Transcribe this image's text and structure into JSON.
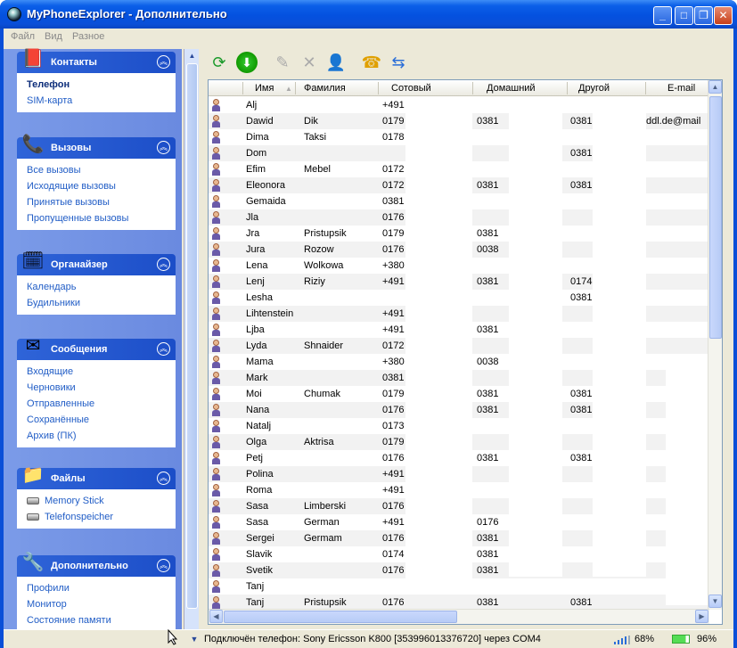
{
  "window": {
    "title": "MyPhoneExplorer -  Дополнительно"
  },
  "menu": [
    "Файл",
    "Вид",
    "Разное"
  ],
  "nav": [
    {
      "title": "Контакты",
      "icon": "contacts-book-icon",
      "items": [
        "Телефон",
        "SIM-карта"
      ],
      "selected": 0
    },
    {
      "title": "Вызовы",
      "icon": "phone-calls-icon",
      "items": [
        "Все вызовы",
        "Исходящие вызовы",
        "Принятые вызовы",
        "Пропущенные вызовы"
      ]
    },
    {
      "title": "Органайзер",
      "icon": "organizer-icon",
      "items": [
        "Календарь",
        "Будильники"
      ]
    },
    {
      "title": "Сообщения",
      "icon": "envelope-icon",
      "items": [
        "Входящие",
        "Черновики",
        "Отправленные",
        "Сохранённые",
        "Архив (ПК)"
      ]
    },
    {
      "title": "Файлы",
      "icon": "folder-icon",
      "items": [
        "Memory Stick",
        "Telefonspeicher"
      ]
    },
    {
      "title": "Дополнительно",
      "icon": "wrench-icon",
      "items": [
        "Профили",
        "Монитор",
        "Состояние памяти"
      ]
    }
  ],
  "toolbar": [
    "refresh-icon",
    "download-icon",
    "edit-icon",
    "delete-icon",
    "add-contact-icon",
    "call-icon",
    "sync-icon"
  ],
  "columns": [
    "Имя",
    "Фамилия",
    "Сотовый",
    "Домашний",
    "Другой",
    "E-mail"
  ],
  "rows": [
    [
      "Alj",
      "",
      "+491",
      "",
      "",
      ""
    ],
    [
      "Dawid",
      "Dik",
      "0179",
      "0381",
      "0381",
      "ddl.de@mail"
    ],
    [
      "Dima",
      "Taksi",
      "0178",
      "",
      "",
      ""
    ],
    [
      "Dom",
      "",
      "",
      "",
      "0381",
      ""
    ],
    [
      "Efim",
      "Mebel",
      "0172",
      "",
      "",
      ""
    ],
    [
      "Eleonora",
      "",
      "0172",
      "0381",
      "0381",
      ""
    ],
    [
      "Gemaida",
      "",
      "0381",
      "",
      "",
      ""
    ],
    [
      "Jla",
      "",
      "0176",
      "",
      "",
      ""
    ],
    [
      "Jra",
      "Pristupsik",
      "0179",
      "0381",
      "",
      ""
    ],
    [
      "Jura",
      "Rozow",
      "0176",
      "0038",
      "",
      ""
    ],
    [
      "Lena",
      "Wolkowa",
      "+380",
      "",
      "",
      ""
    ],
    [
      "Lenj",
      "Riziy",
      "+491",
      "0381",
      "0174",
      ""
    ],
    [
      "Lesha",
      "",
      "",
      "",
      "0381",
      ""
    ],
    [
      "Lihtenstein",
      "",
      "+491",
      "",
      "",
      ""
    ],
    [
      "Ljba",
      "",
      "+491",
      "0381",
      "",
      ""
    ],
    [
      "Lyda",
      "Shnaider",
      "0172",
      "",
      "",
      ""
    ],
    [
      "Mama",
      "",
      "+380",
      "0038",
      "",
      ""
    ],
    [
      "Mark",
      "",
      "0381",
      "",
      "",
      ""
    ],
    [
      "Moi",
      "Chumak",
      "0179",
      "0381",
      "0381",
      ""
    ],
    [
      "Nana",
      "",
      "0176",
      "0381",
      "0381",
      ""
    ],
    [
      "Natalj",
      "",
      "0173",
      "",
      "",
      ""
    ],
    [
      "Olga",
      "Aktrisa",
      "0179",
      "",
      "",
      ""
    ],
    [
      "Petj",
      "",
      "0176",
      "0381",
      "0381",
      ""
    ],
    [
      "Polina",
      "",
      "+491",
      "",
      "",
      ""
    ],
    [
      "Roma",
      "",
      "+491",
      "",
      "",
      ""
    ],
    [
      "Sasa",
      "Limberski",
      "0176",
      "",
      "",
      ""
    ],
    [
      "Sasa",
      "German",
      "+491",
      "0176",
      "",
      ""
    ],
    [
      "Sergei",
      "Germam",
      "0176",
      "0381",
      "",
      ""
    ],
    [
      "Slavik",
      "",
      "0174",
      "0381",
      "",
      ""
    ],
    [
      "Svetik",
      "",
      "0176",
      "0381",
      "",
      ""
    ],
    [
      "Tanj",
      "",
      "",
      "",
      "",
      ""
    ],
    [
      "Tanj",
      "Pristupsik",
      "0176",
      "0381",
      "0381",
      ""
    ]
  ],
  "status": {
    "text": "Подключён телефон: Sony Ericsson K800 [353996013376720] через COM4",
    "signal": "68%",
    "battery": "96%"
  }
}
